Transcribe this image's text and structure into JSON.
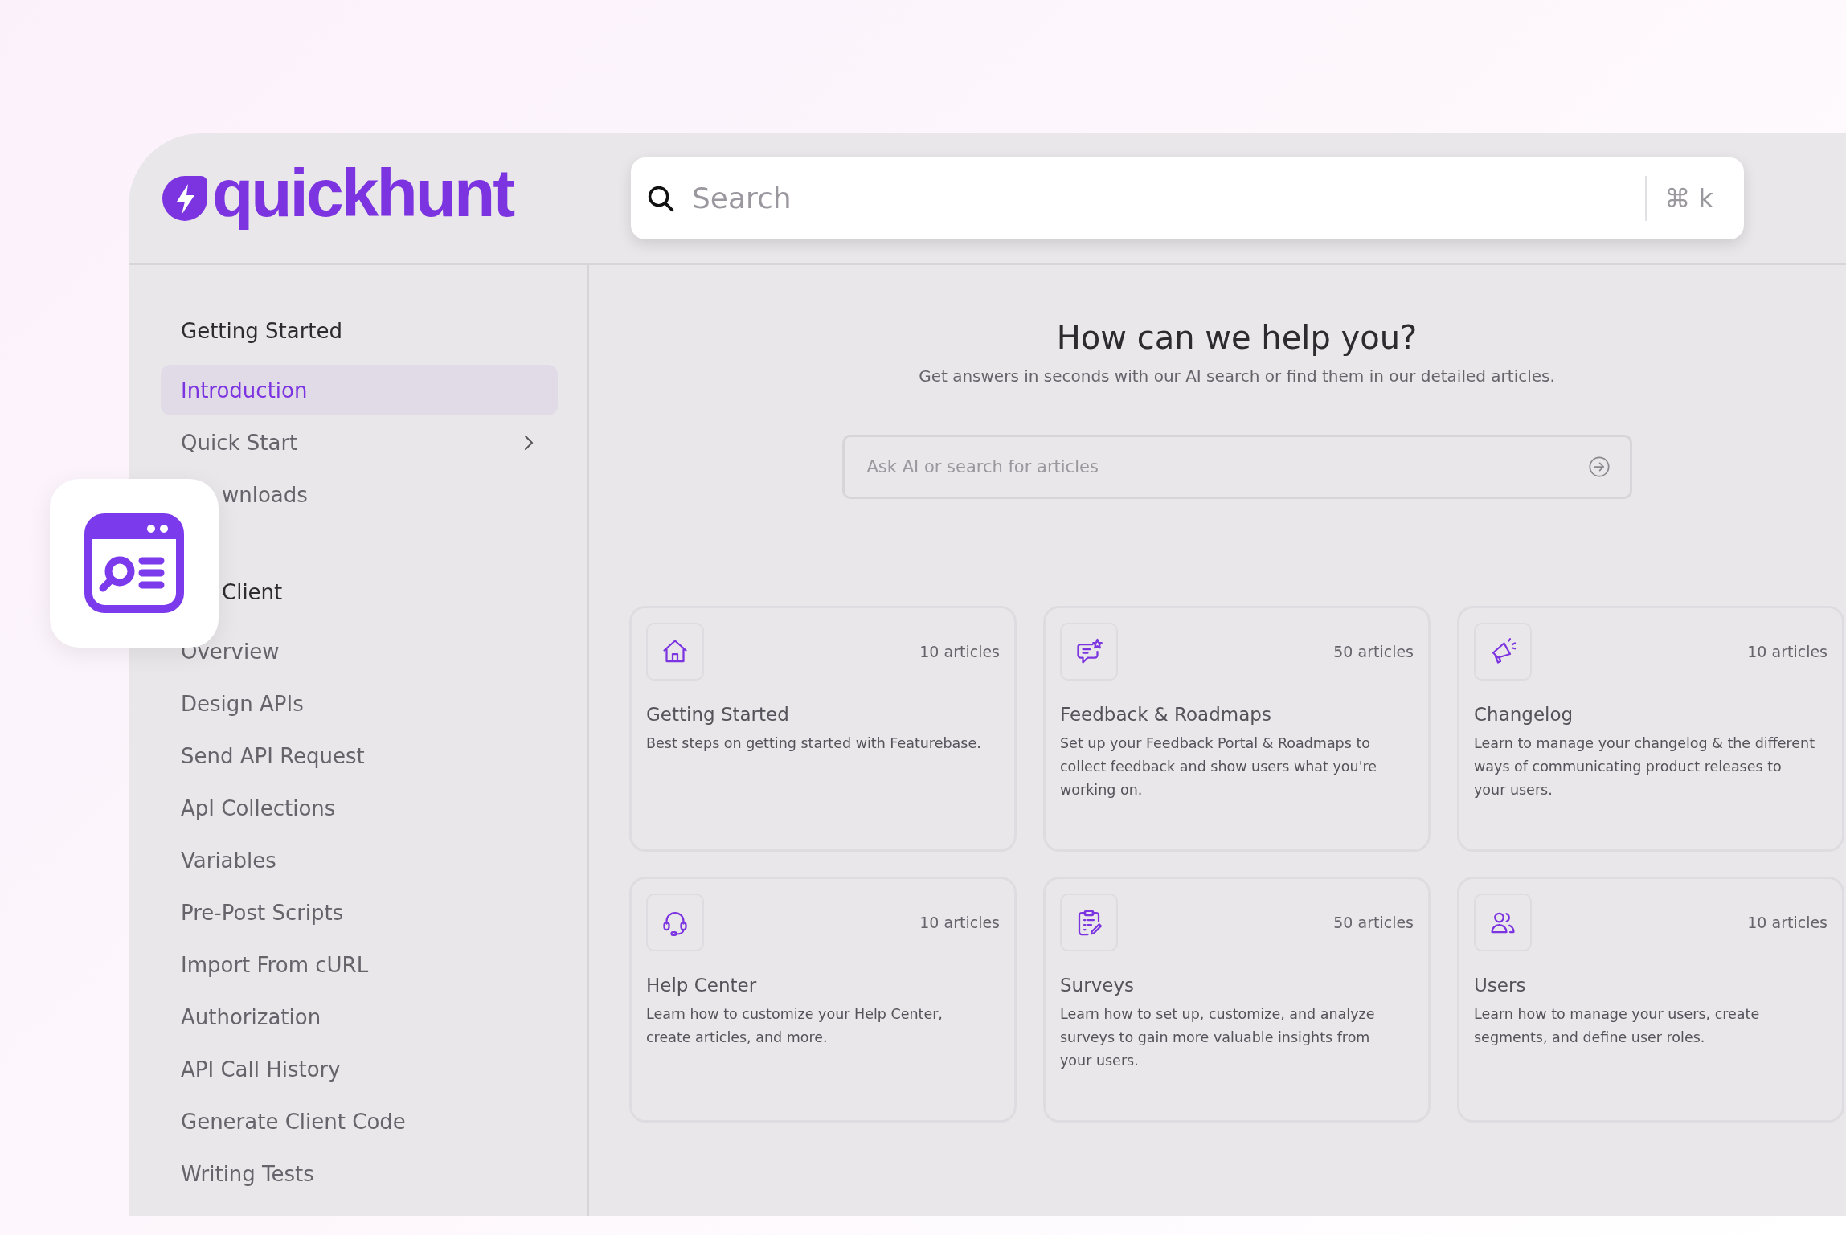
{
  "logo": {
    "text": "quickhunt"
  },
  "search": {
    "placeholder": "Search",
    "shortcut": "⌘ k"
  },
  "sidebar": {
    "sections": [
      {
        "title": "Getting Started",
        "partial": false,
        "items": [
          {
            "label": "Introduction",
            "selected": true,
            "has_children": false,
            "partial": false
          },
          {
            "label": "Quick Start",
            "selected": false,
            "has_children": true,
            "partial": false
          },
          {
            "label": "wnloads",
            "selected": false,
            "has_children": false,
            "partial": true
          }
        ]
      },
      {
        "title": "Client",
        "partial": true,
        "items": [
          {
            "label": "Overview",
            "selected": false,
            "has_children": false,
            "partial": false
          },
          {
            "label": "Design APIs",
            "selected": false,
            "has_children": false,
            "partial": false
          },
          {
            "label": "Send API  Request",
            "selected": false,
            "has_children": false,
            "partial": false
          },
          {
            "label": "ApI Collections",
            "selected": false,
            "has_children": false,
            "partial": false
          },
          {
            "label": "Variables",
            "selected": false,
            "has_children": false,
            "partial": false
          },
          {
            "label": "Pre-Post Scripts",
            "selected": false,
            "has_children": false,
            "partial": false
          },
          {
            "label": "Import From cURL",
            "selected": false,
            "has_children": false,
            "partial": false
          },
          {
            "label": "Authorization",
            "selected": false,
            "has_children": false,
            "partial": false
          },
          {
            "label": "API Call History",
            "selected": false,
            "has_children": false,
            "partial": false
          },
          {
            "label": "Generate Client Code",
            "selected": false,
            "has_children": false,
            "partial": false
          },
          {
            "label": "Writing Tests",
            "selected": false,
            "has_children": false,
            "partial": false
          }
        ]
      }
    ]
  },
  "hero": {
    "title": "How can we help you?",
    "subtitle": "Get answers in seconds with our AI search or find them in our detailed articles.",
    "ask_placeholder": "Ask AI or search for articles"
  },
  "cards": [
    {
      "title": "Getting Started",
      "count": "10 articles",
      "description": "Best steps on getting started with Featurebase."
    },
    {
      "title": "Feedback & Roadmaps",
      "count": "50 articles",
      "description": "Set up your Feedback Portal & Roadmaps to collect feedback and show users what you're working on."
    },
    {
      "title": "Changelog",
      "count": "10 articles",
      "description": "Learn to manage your changelog & the different ways of communicating product releases to your users."
    },
    {
      "title": "Help Center",
      "count": "10 articles",
      "description": "Learn how to customize your Help Center, create articles, and more."
    },
    {
      "title": "Surveys",
      "count": "50 articles",
      "description": "Learn how to set up, customize, and analyze surveys to gain more valuable insights from your users."
    },
    {
      "title": "Users",
      "count": "10 articles",
      "description": "Learn how to manage your users, create segments, and define user roles."
    }
  ]
}
